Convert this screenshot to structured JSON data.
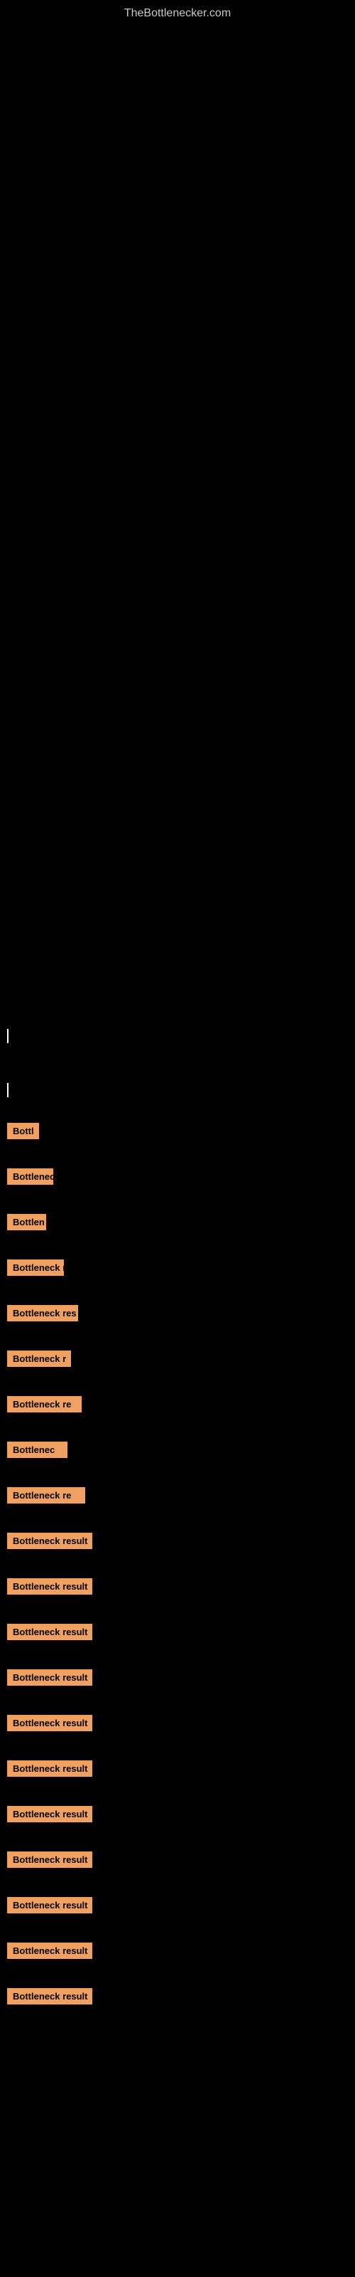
{
  "header": {
    "title": "TheBottlenecker.com"
  },
  "results": [
    {
      "id": 1,
      "label": "Bottleneck result",
      "width_class": "label-w1",
      "short": "Bottl"
    },
    {
      "id": 2,
      "label": "Bottleneck result",
      "width_class": "label-w2",
      "short": "Bottlenec"
    },
    {
      "id": 3,
      "label": "Bottleneck result",
      "width_class": "label-w3",
      "short": "Bottlen"
    },
    {
      "id": 4,
      "label": "Bottleneck result",
      "width_class": "label-w4",
      "short": "Bottleneck r"
    },
    {
      "id": 5,
      "label": "Bottleneck result",
      "width_class": "label-w5",
      "short": "Bottleneck res"
    },
    {
      "id": 6,
      "label": "Bottleneck result",
      "width_class": "label-w6",
      "short": "Bottleneck r"
    },
    {
      "id": 7,
      "label": "Bottleneck result",
      "width_class": "label-w7",
      "short": "Bottleneck re"
    },
    {
      "id": 8,
      "label": "Bottleneck result",
      "width_class": "label-w8",
      "short": "Bottlenec"
    },
    {
      "id": 9,
      "label": "Bottleneck result",
      "width_class": "label-w9",
      "short": "Bottleneck re"
    },
    {
      "id": 10,
      "label": "Bottleneck result",
      "width_class": "label-w10",
      "short": "Bottleneck result"
    },
    {
      "id": 11,
      "label": "Bottleneck result",
      "width_class": "label-w11",
      "short": "Bottleneck result"
    },
    {
      "id": 12,
      "label": "Bottleneck result",
      "width_class": "label-w12",
      "short": "Bottleneck result"
    },
    {
      "id": 13,
      "label": "Bottleneck result",
      "width_class": "label-w13",
      "short": "Bottleneck result"
    },
    {
      "id": 14,
      "label": "Bottleneck result",
      "width_class": "label-w14",
      "short": "Bottleneck result"
    },
    {
      "id": 15,
      "label": "Bottleneck result",
      "width_class": "label-w15",
      "short": "Bottleneck result"
    },
    {
      "id": 16,
      "label": "Bottleneck result",
      "width_class": "label-w16",
      "short": "Bottleneck result"
    },
    {
      "id": 17,
      "label": "Bottleneck result",
      "width_class": "label-w17",
      "short": "Bottleneck result"
    },
    {
      "id": 18,
      "label": "Bottleneck result",
      "width_class": "label-w18",
      "short": "Bottleneck result"
    },
    {
      "id": 19,
      "label": "Bottleneck result",
      "width_class": "label-w19",
      "short": "Bottleneck result"
    },
    {
      "id": 20,
      "label": "Bottleneck result",
      "width_class": "label-w20",
      "short": "Bottleneck result"
    }
  ],
  "colors": {
    "background": "#000000",
    "label_bg": "#f0a060",
    "label_text": "#000000",
    "title_text": "#c8c8c8"
  }
}
